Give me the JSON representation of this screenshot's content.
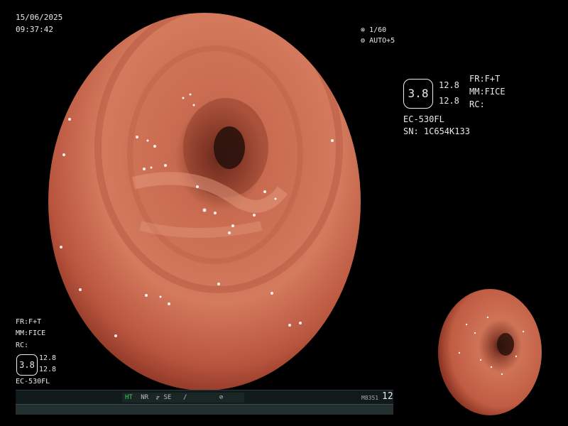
{
  "datetime": {
    "date": "15/06/2025",
    "time": "09:37:42"
  },
  "exposure": {
    "shutter": "1/60",
    "auto": "AUTO+5",
    "shutter_icon": "circle-icon",
    "auto_icon": "gear-icon"
  },
  "right_panel": {
    "scope_value": "3.8",
    "value_top": "12.8",
    "value_bottom": "12.8",
    "fr": "FR:F+T",
    "mm": "MM:FICE",
    "rc": "RC:",
    "model": "EC-530FL",
    "serial": "SN: 1C654K133"
  },
  "left_panel": {
    "fr": "FR:F+T",
    "mm": "MM:FICE",
    "rc": "RC:",
    "scope_value": "3.8",
    "value_top": "12.8",
    "value_bottom": "12.8",
    "model": "EC-530FL"
  },
  "status_bar": {
    "ht": "HT",
    "nr": "NR",
    "se": "SE",
    "code": "M8351",
    "number": "12"
  },
  "colors": {
    "tissue": "#c9654c",
    "background": "#000000",
    "bar": "#101a1a",
    "accent_green": "#3bd15a"
  }
}
